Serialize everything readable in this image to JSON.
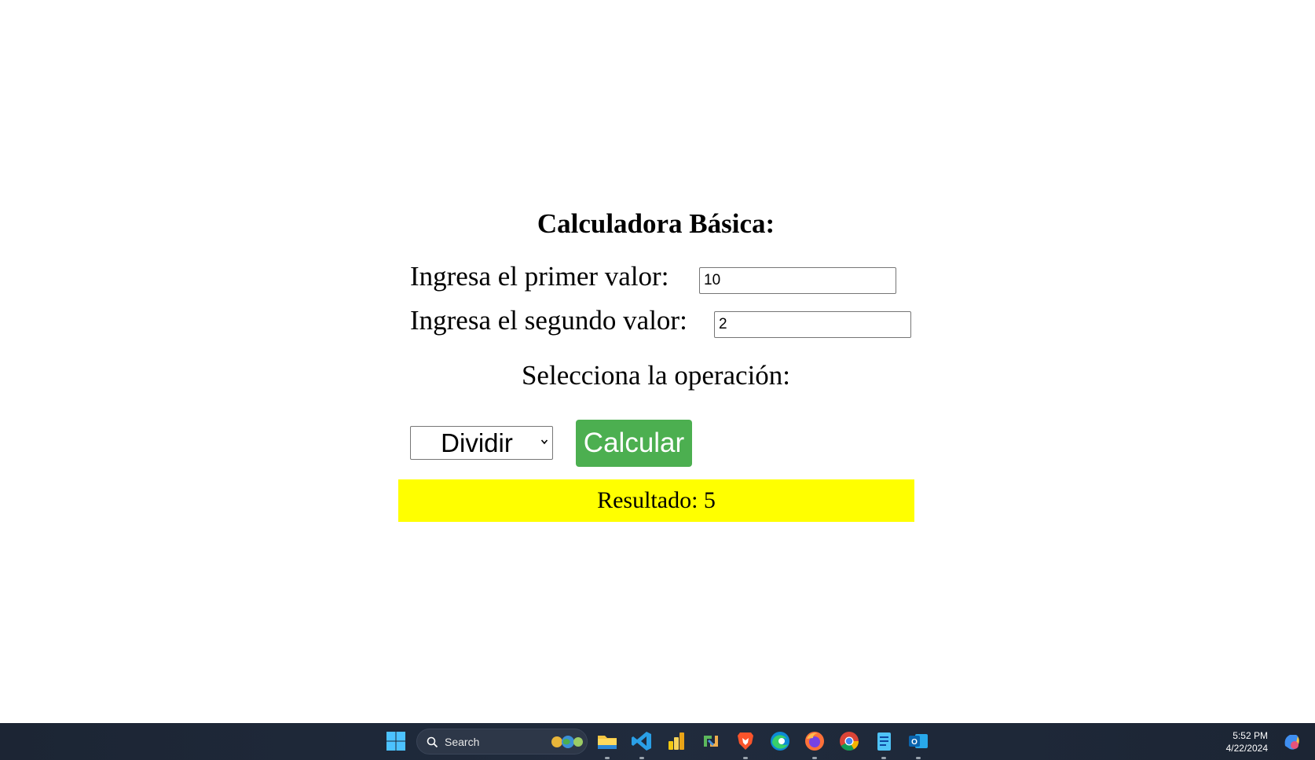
{
  "calculator": {
    "title": "Calculadora Básica:",
    "first_label": "Ingresa el primer valor:",
    "first_value": "10",
    "second_label": "Ingresa el segundo valor:",
    "second_value": "2",
    "operation_label": "Selecciona la operación:",
    "operation_selected": "Dividir",
    "calculate_button": "Calcular",
    "result_text": "Resultado: 5",
    "colors": {
      "button": "#4caf50",
      "result_bg": "#ffff00"
    }
  },
  "taskbar": {
    "search_placeholder": "Search",
    "apps": [
      "start-icon",
      "file-explorer-icon",
      "vscode-icon",
      "power-bi-icon",
      "sync-app-icon",
      "brave-icon",
      "edge-icon",
      "firefox-icon",
      "chrome-icon",
      "notepad-icon",
      "outlook-icon"
    ],
    "time": "5:52 PM",
    "date": "4/22/2024"
  }
}
